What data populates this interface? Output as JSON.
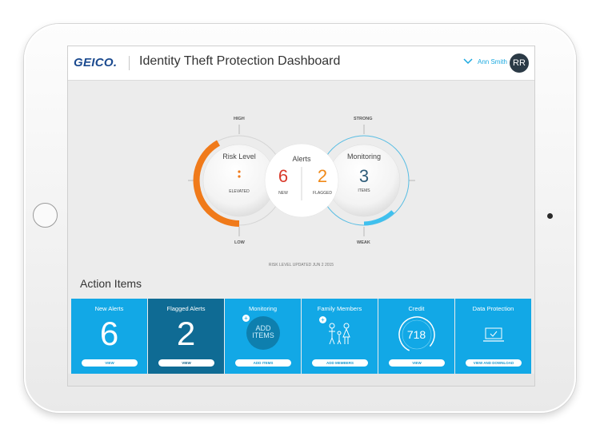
{
  "header": {
    "logo": "GEICO.",
    "title": "Identity Theft Protection Dashboard",
    "user_name": "Ann Smith",
    "avatar_initials": "RR"
  },
  "dashboard": {
    "risk": {
      "title": "Risk Level",
      "status": "ELEVATED",
      "level_fraction": 0.55,
      "icon": "alert-dots-icon"
    },
    "alerts": {
      "title": "Alerts",
      "new_count": "6",
      "new_label": "NEW",
      "flagged_count": "2",
      "flagged_label": "FLAGGED"
    },
    "monitoring": {
      "title": "Monitoring",
      "count": "3",
      "label": "ITEMS",
      "strength_fraction": 0.3
    },
    "axis": {
      "high": "HIGH",
      "low": "LOW",
      "strong": "STRONG",
      "weak": "WEAK"
    },
    "risk_updated": "RISK LEVEL UPDATED JUN 2 2015"
  },
  "action_items": {
    "title": "Action Items",
    "tiles": [
      {
        "label": "New Alerts",
        "value": "6",
        "button": "VIEW"
      },
      {
        "label": "Flagged Alerts",
        "value": "2",
        "button": "VIEW"
      },
      {
        "label": "Monitoring",
        "value": "ADD ITEMS",
        "button": "ADD ITEMS",
        "icon": "plus-icon"
      },
      {
        "label": "Family Members",
        "value": "",
        "button": "ADD MEMBERS",
        "icon": "family-icon"
      },
      {
        "label": "Credit",
        "value": "718",
        "button": "VIEW",
        "icon": "credit-gauge-icon"
      },
      {
        "label": "Data Protection",
        "value": "",
        "button": "VIEW AND DOWNLOAD",
        "icon": "laptop-check-icon"
      }
    ]
  },
  "colors": {
    "accent_blue": "#1aa9e0",
    "tile_blue": "#12a8e6",
    "tile_dark": "#0f6b94",
    "risk_orange": "#f07a1a",
    "alert_red": "#d93a2b",
    "flag_orange": "#f08a1a",
    "monitor_navy": "#2f5d7a",
    "logo_blue": "#1b4a8f"
  }
}
